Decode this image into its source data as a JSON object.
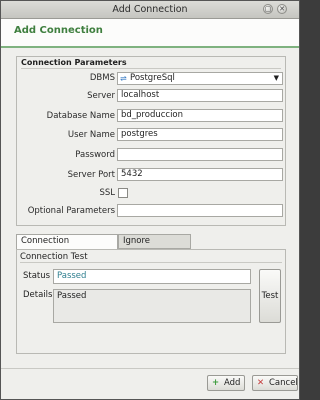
{
  "window": {
    "title": "Add Connection"
  },
  "banner": {
    "heading": "Add Connection"
  },
  "connection_parameters": {
    "legend": "Connection Parameters",
    "fields": {
      "dbms": {
        "label": "DBMS",
        "value": "PostgreSql",
        "icon": "database-icon"
      },
      "server": {
        "label": "Server",
        "value": "localhost"
      },
      "database_name": {
        "label": "Database Name",
        "value": "bd_produccion"
      },
      "user_name": {
        "label": "User Name",
        "value": "postgres"
      },
      "password": {
        "label": "Password",
        "value": ""
      },
      "server_port": {
        "label": "Server Port",
        "value": "5432"
      },
      "ssl": {
        "label": "SSL",
        "checked": false
      },
      "optional_parameters": {
        "label": "Optional Parameters",
        "value": ""
      }
    }
  },
  "tabs": [
    {
      "label": "Connection Parameters",
      "active": true
    },
    {
      "label": "Ignore Schemas",
      "active": false
    }
  ],
  "connection_test": {
    "legend": "Connection Test",
    "status_label": "Status",
    "status_value": "Passed",
    "details_label": "Details",
    "details_value": "Passed",
    "test_button": "Test"
  },
  "footer": {
    "add_button": "Add",
    "cancel_button": "Cancel"
  },
  "colors": {
    "accent_green": "#3f7f3f",
    "status_text": "#2f7f8f"
  }
}
